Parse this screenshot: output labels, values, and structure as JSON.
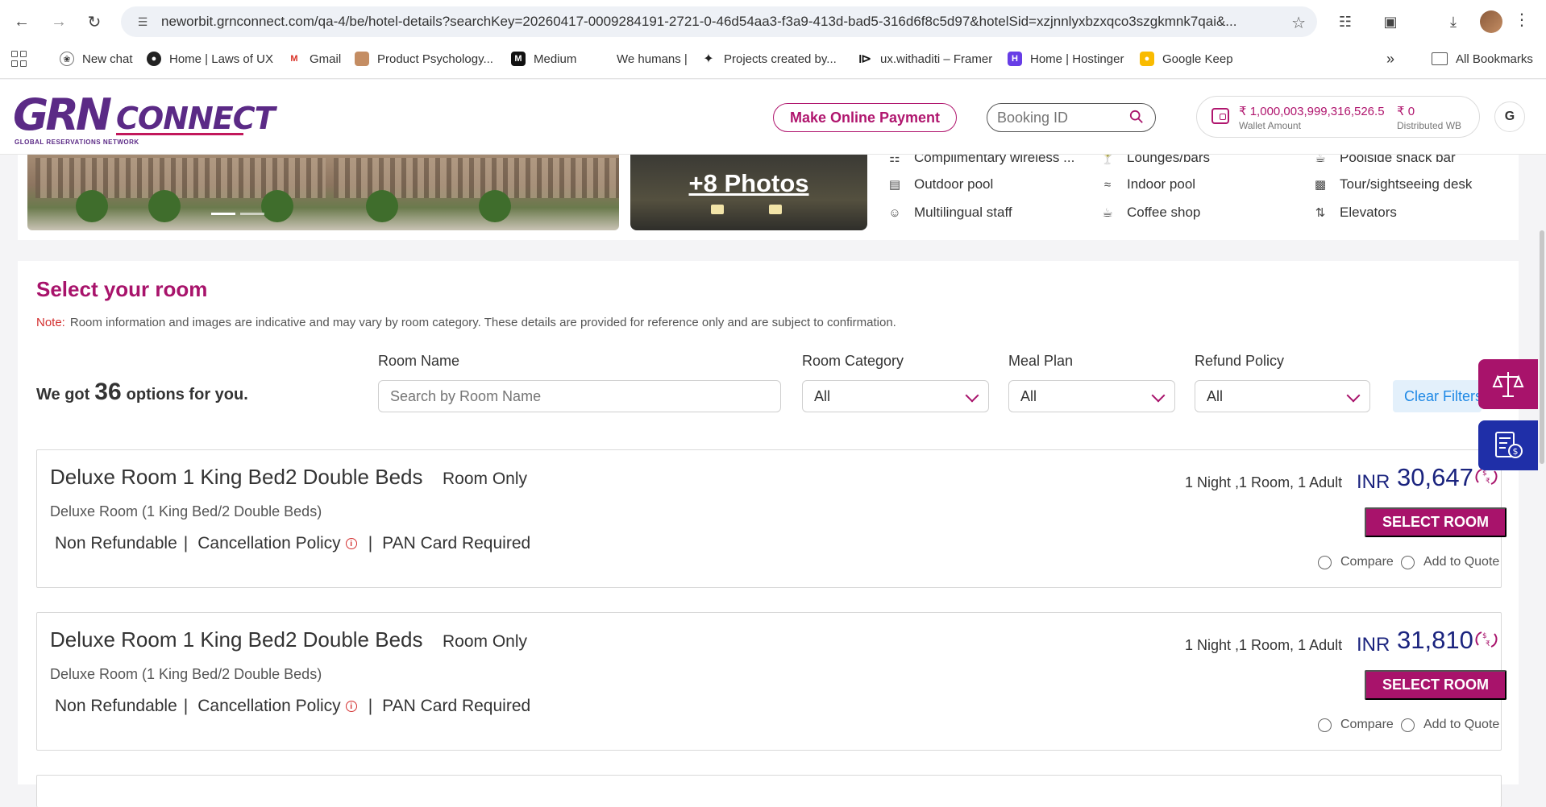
{
  "browser": {
    "url": "neworbit.grnconnect.com/qa-4/be/hotel-details?searchKey=20260417-0009284191-2721-0-46d54aa3-f3a9-413d-bad5-316d6f8c5d97&hotelSid=xzjnnlyxbzxqco3szgkmnk7qai&...",
    "bookmarks": [
      "New chat",
      "Home | Laws of UX",
      "Gmail",
      "Product Psychology...",
      "Medium",
      "We humans |",
      "Projects created by...",
      "ux.withaditi – Framer",
      "Home | Hostinger",
      "Google Keep"
    ],
    "all_bookmarks": "All Bookmarks"
  },
  "header": {
    "logo_main": "GRN",
    "logo_connect": "CONNECT",
    "logo_sub": "GLOBAL RESERVATIONS NETWORK",
    "make_payment": "Make Online Payment",
    "booking_placeholder": "Booking ID",
    "wallet_amount": "₹ 1,000,003,999,316,526.5",
    "wallet_label": "Wallet Amount",
    "distributed_amount": "₹ 0",
    "distributed_label": "Distributed WB",
    "user_initial": "G",
    "brand_color": "#a8136b"
  },
  "hotel": {
    "more_photos": "+8 Photos",
    "amenities": [
      {
        "label": "Complimentary wireless ...",
        "icon": "wifi-icon"
      },
      {
        "label": "Lounges/bars",
        "icon": "cocktail-icon"
      },
      {
        "label": "Poolside snack bar",
        "icon": "snack-icon"
      },
      {
        "label": "Outdoor pool",
        "icon": "pool-icon"
      },
      {
        "label": "Indoor pool",
        "icon": "swim-icon"
      },
      {
        "label": "Tour/sightseeing desk",
        "icon": "bus-icon"
      },
      {
        "label": "Multilingual staff",
        "icon": "staff-icon"
      },
      {
        "label": "Coffee shop",
        "icon": "coffee-icon"
      },
      {
        "label": "Elevators",
        "icon": "elevator-icon"
      }
    ]
  },
  "select_room": {
    "title": "Select your room",
    "note_label": "Note:",
    "note_text": "Room information and images are indicative and may vary by room category. These details are provided for reference only and are subject to confirmation.",
    "options_prefix": "We got",
    "options_count": "36",
    "options_suffix": "options for you.",
    "filters": {
      "room_name_label": "Room Name",
      "room_name_placeholder": "Search by Room Name",
      "room_category_label": "Room Category",
      "room_category_value": "All",
      "meal_plan_label": "Meal Plan",
      "meal_plan_value": "All",
      "refund_policy_label": "Refund Policy",
      "refund_policy_value": "All",
      "clear": "Clear Filters"
    },
    "rooms": [
      {
        "name": "Deluxe Room 1 King Bed2 Double Beds",
        "meal": "Room Only",
        "subtitle": "Deluxe Room (1 King Bed/2 Double Beds)",
        "refund": "Non Refundable",
        "cancellation": "Cancellation Policy",
        "pan": "PAN Card Required",
        "stay": "1 Night ,1 Room, 1 Adult",
        "currency": "INR",
        "price": "30,647",
        "select": "SELECT ROOM",
        "compare": "Compare",
        "quote": "Add to Quote"
      },
      {
        "name": "Deluxe Room 1 King Bed2 Double Beds",
        "meal": "Room Only",
        "subtitle": "Deluxe Room (1 King Bed/2 Double Beds)",
        "refund": "Non Refundable",
        "cancellation": "Cancellation Policy",
        "pan": "PAN Card Required",
        "stay": "1 Night ,1 Room, 1 Adult",
        "currency": "INR",
        "price": "31,810",
        "select": "SELECT ROOM",
        "compare": "Compare",
        "quote": "Add to Quote"
      }
    ]
  }
}
